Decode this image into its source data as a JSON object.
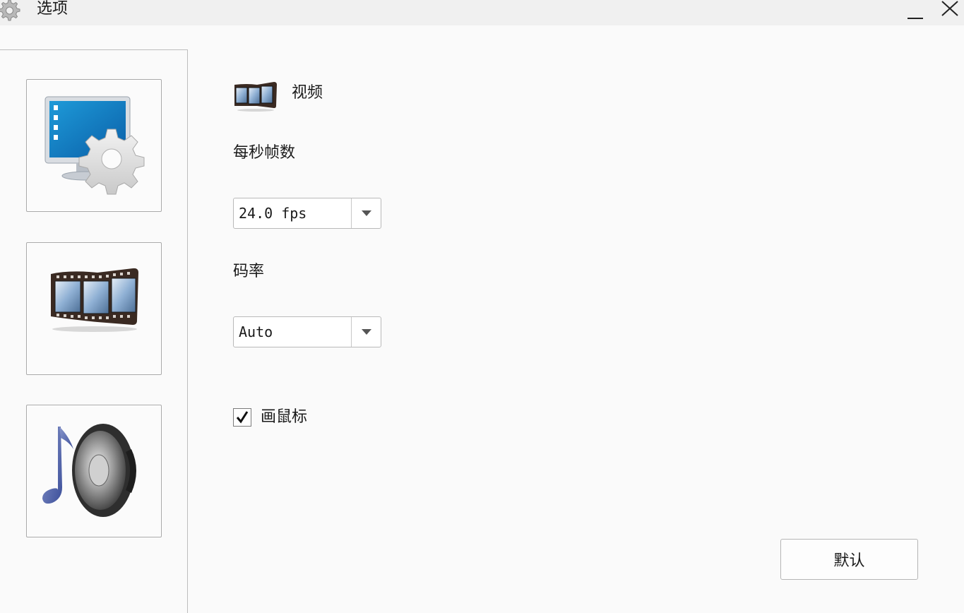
{
  "window": {
    "title": "选项",
    "icons": {
      "app": "gear-icon",
      "minimize": "minimize-icon",
      "close": "close-icon"
    }
  },
  "sidebar": {
    "items": [
      {
        "name": "display-settings",
        "icon": "monitor-gear-icon"
      },
      {
        "name": "video",
        "icon": "film-strip-icon",
        "selected": true
      },
      {
        "name": "audio",
        "icon": "speaker-music-icon"
      }
    ]
  },
  "section": {
    "title": "视频",
    "icon": "film-strip-icon"
  },
  "fps": {
    "label": "每秒帧数",
    "value": "24.0 fps"
  },
  "bitrate": {
    "label": "码率",
    "value": "Auto"
  },
  "draw_cursor": {
    "label": "画鼠标",
    "checked": true
  },
  "buttons": {
    "default_label": "默认"
  },
  "colors": {
    "window_bg": "#fafafa",
    "titlebar_bg": "#f0f0f0",
    "border": "#b9b9b9"
  }
}
